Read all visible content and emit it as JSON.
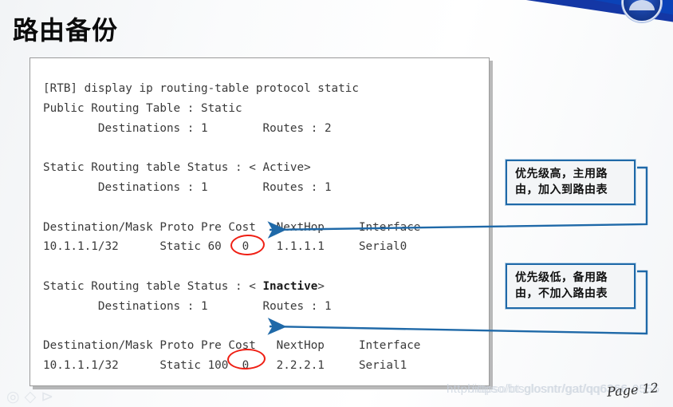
{
  "slide": {
    "title": "路由备份",
    "page_label": "Page 12"
  },
  "banner": {
    "color": "#1437a5",
    "logo_name": "circular-emblem-logo"
  },
  "terminal": {
    "command_prompt": "[RTB] display ip routing-table protocol static",
    "lines": [
      "[RTB] display ip routing-table protocol static",
      "Public Routing Table : Static",
      "         Destinations : 1        Routes : 2",
      "",
      "Static Routing table Status : < Active>",
      "         Destinations : 1        Routes : 1",
      "",
      "Destination/Mask Proto Pre Cost   NextHop     Interface",
      "10.1.1.1/32      Static 60   0    1.1.1.1     Serial0",
      "",
      "Static Routing table Status : < Inactive>",
      "         Destinations : 1        Routes : 1",
      "",
      "Destination/Mask Proto Pre Cost   NextHop     Interface",
      "10.1.1.1/32      Static 100  0    2.2.2.1     Serial1"
    ],
    "blocks": {
      "header": {
        "command": "[RTB] display ip routing-table protocol static",
        "table_name": "Public Routing Table : Static",
        "destinations": "Destinations : 1",
        "routes": "Routes : 2"
      },
      "active": {
        "status": "Static Routing table Status : < Active>",
        "status_value": "Active",
        "destinations": "Destinations : 1",
        "routes": "Routes : 1",
        "columns": "Destination/Mask Proto Pre Cost   NextHop     Interface",
        "row": "10.1.1.1/32      Static 60   0    1.1.1.1     Serial0",
        "dest_mask": "10.1.1.1/32",
        "proto": "Static",
        "pre": "60",
        "cost": "0",
        "next_hop": "1.1.1.1",
        "interface": "Serial0"
      },
      "inactive": {
        "status": "Static Routing table Status : < Inactive>",
        "status_value": "Inactive",
        "destinations": "Destinations : 1",
        "routes": "Routes : 1",
        "columns": "Destination/Mask Proto Pre Cost   NextHop     Interface",
        "row": "10.1.1.1/32      Static 100  0    2.2.2.1     Serial1",
        "dest_mask": "10.1.1.1/32",
        "proto": "Static",
        "pre": "100",
        "cost": "0",
        "next_hop": "2.2.2.1",
        "interface": "Serial1"
      }
    }
  },
  "annotations": {
    "highlight_color": "#ef1f14",
    "connector_color": "#1f69a8",
    "highlights": [
      {
        "name": "pre-60",
        "value": "60"
      },
      {
        "name": "pre-100",
        "value": "100"
      }
    ],
    "callouts": [
      {
        "name": "primary-route-callout",
        "text": "优先级高，主用路由，加入到路由表"
      },
      {
        "name": "backup-route-callout",
        "text": "优先级低，备用路由，不加入路由表"
      }
    ]
  },
  "watermarks": {
    "url_primary": "httpbittpso/btsglosntr/gat/qq6366-0555",
    "url_secondary": "httpso/bt.glosntr/gat/qq6366",
    "mark": "◎ ◇ ⊳"
  }
}
